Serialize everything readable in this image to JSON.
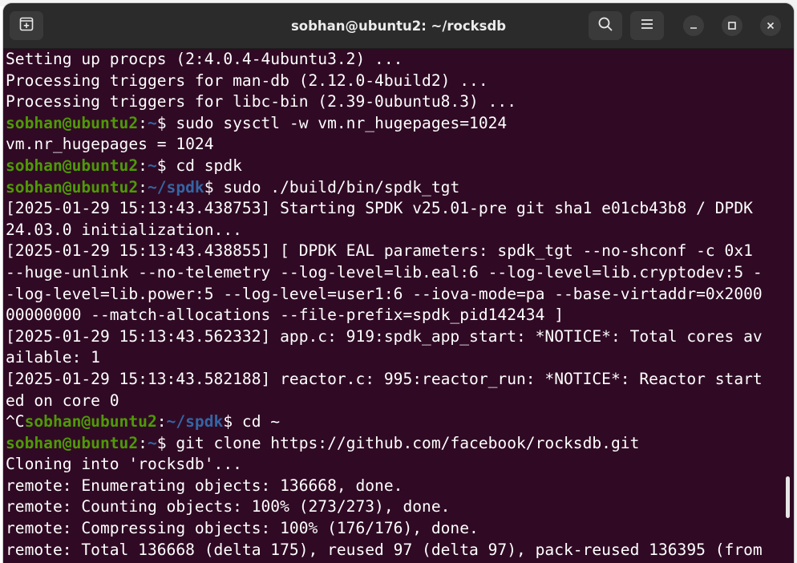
{
  "window": {
    "title": "sobhan@ubuntu2: ~/rocksdb",
    "buttons": {
      "new_tab_icon": "new-tab-icon",
      "search_icon": "search-icon",
      "menu_icon": "hamburger-menu-icon",
      "minimize_icon": "minimize-icon",
      "maximize_icon": "maximize-icon",
      "close_icon": "close-icon"
    }
  },
  "colors": {
    "background": "#300a24",
    "prompt_user": "#4e9a06",
    "prompt_path": "#3465a4",
    "text": "#ffffff"
  },
  "terminal": {
    "lines": [
      {
        "text": "Setting up procps (2:4.0.4-4ubuntu3.2) ..."
      },
      {
        "text": "Processing triggers for man-db (2.12.0-4build2) ..."
      },
      {
        "text": "Processing triggers for libc-bin (2.39-0ubuntu8.3) ..."
      },
      {
        "pre": "",
        "user": "sobhan@ubuntu2",
        "sep": ":",
        "path": "~",
        "cmd": "$ sudo sysctl -w vm.nr_hugepages=1024"
      },
      {
        "text": "vm.nr_hugepages = 1024"
      },
      {
        "pre": "",
        "user": "sobhan@ubuntu2",
        "sep": ":",
        "path": "~",
        "cmd": "$ cd spdk"
      },
      {
        "pre": "",
        "user": "sobhan@ubuntu2",
        "sep": ":",
        "path": "~/spdk",
        "cmd": "$ sudo ./build/bin/spdk_tgt"
      },
      {
        "text": "[2025-01-29 15:13:43.438753] Starting SPDK v25.01-pre git sha1 e01cb43b8 / DPDK"
      },
      {
        "text": "24.03.0 initialization..."
      },
      {
        "text": "[2025-01-29 15:13:43.438855] [ DPDK EAL parameters: spdk_tgt --no-shconf -c 0x1"
      },
      {
        "text": "--huge-unlink --no-telemetry --log-level=lib.eal:6 --log-level=lib.cryptodev:5 -"
      },
      {
        "text": "-log-level=lib.power:5 --log-level=user1:6 --iova-mode=pa --base-virtaddr=0x2000"
      },
      {
        "text": "00000000 --match-allocations --file-prefix=spdk_pid142434 ]"
      },
      {
        "text": "[2025-01-29 15:13:43.562332] app.c: 919:spdk_app_start: *NOTICE*: Total cores av"
      },
      {
        "text": "ailable: 1"
      },
      {
        "text": "[2025-01-29 15:13:43.582188] reactor.c: 995:reactor_run: *NOTICE*: Reactor start"
      },
      {
        "text": "ed on core 0"
      },
      {
        "pre": "^C",
        "user": "sobhan@ubuntu2",
        "sep": ":",
        "path": "~/spdk",
        "cmd": "$ cd ~"
      },
      {
        "pre": "",
        "user": "sobhan@ubuntu2",
        "sep": ":",
        "path": "~",
        "cmd": "$ git clone https://github.com/facebook/rocksdb.git"
      },
      {
        "text": "Cloning into 'rocksdb'..."
      },
      {
        "text": "remote: Enumerating objects: 136668, done."
      },
      {
        "text": "remote: Counting objects: 100% (273/273), done."
      },
      {
        "text": "remote: Compressing objects: 100% (176/176), done."
      },
      {
        "text": "remote: Total 136668 (delta 175), reused 97 (delta 97), pack-reused 136395 (from"
      }
    ]
  }
}
